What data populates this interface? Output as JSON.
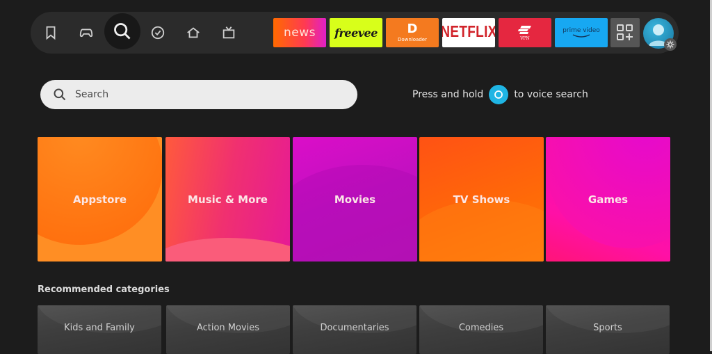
{
  "nav": {
    "icons": [
      {
        "name": "watchlist",
        "icon": "bookmark-icon"
      },
      {
        "name": "games",
        "icon": "gamepad-icon"
      },
      {
        "name": "search",
        "icon": "search-icon",
        "active": true
      },
      {
        "name": "my-stuff",
        "icon": "check-circle-icon"
      },
      {
        "name": "home",
        "icon": "home-icon"
      },
      {
        "name": "live",
        "icon": "tv-icon"
      }
    ],
    "apps": [
      {
        "name": "news",
        "label": "news",
        "color": "#ff3a52"
      },
      {
        "name": "freevee",
        "label": "freevee",
        "color": "#d8ff1a"
      },
      {
        "name": "downloader",
        "logo": "D",
        "label": "Downloader",
        "color": "#f47a1f"
      },
      {
        "name": "netflix",
        "label": "NETFLIX",
        "color": "#ffffff"
      },
      {
        "name": "expressvpn",
        "label": "VPN",
        "color": "#e52740"
      },
      {
        "name": "prime-video",
        "label": "prime video",
        "color": "#17a8f2"
      }
    ],
    "apps_button": "apps-grid-icon",
    "profile": "profile-avatar"
  },
  "search": {
    "placeholder": "Search",
    "value": ""
  },
  "voice_hint": {
    "before": "Press and hold",
    "after": "to voice search",
    "accent": "#1fb5e4"
  },
  "categories": [
    {
      "label": "Appstore",
      "color": "#ff8e24"
    },
    {
      "label": "Music & More",
      "color": "#f03070"
    },
    {
      "label": "Movies",
      "color": "#c010c0"
    },
    {
      "label": "TV Shows",
      "color": "#ff6a08"
    },
    {
      "label": "Games",
      "color": "#ff10a6"
    }
  ],
  "recommended": {
    "title": "Recommended categories",
    "items": [
      "Kids and Family",
      "Action Movies",
      "Documentaries",
      "Comedies",
      "Sports"
    ]
  }
}
